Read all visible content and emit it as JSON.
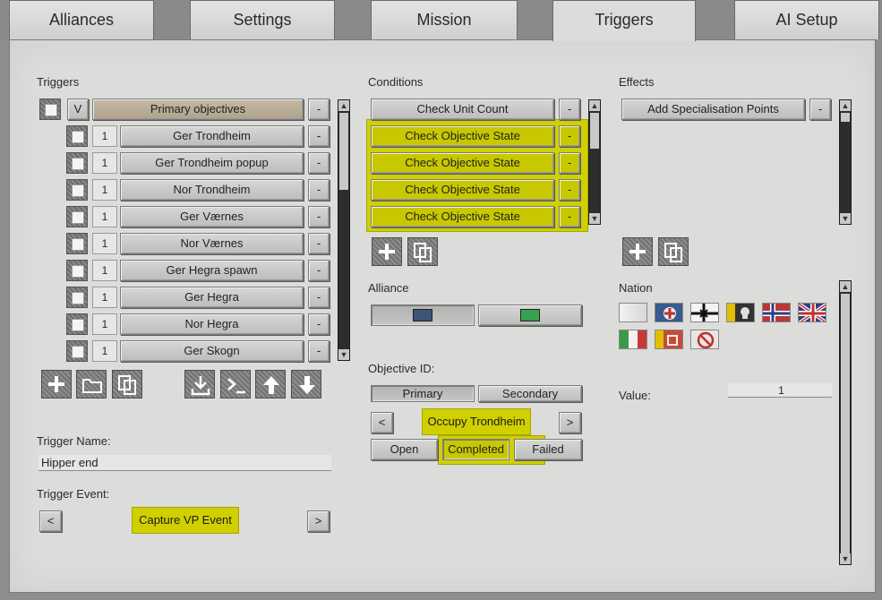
{
  "tabs": [
    "Alliances",
    "Settings",
    "Mission",
    "Triggers",
    "AI Setup"
  ],
  "triggers": {
    "heading": "Triggers",
    "group": {
      "toggle": "V",
      "label": "Primary objectives",
      "minus": "-"
    },
    "items": [
      {
        "count": "1",
        "label": "Ger Trondheim"
      },
      {
        "count": "1",
        "label": "Ger Trondheim popup"
      },
      {
        "count": "1",
        "label": "Nor Trondheim"
      },
      {
        "count": "1",
        "label": "Ger Værnes"
      },
      {
        "count": "1",
        "label": "Nor Værnes"
      },
      {
        "count": "1",
        "label": "Ger Hegra spawn"
      },
      {
        "count": "1",
        "label": "Ger Hegra"
      },
      {
        "count": "1",
        "label": "Nor Hegra"
      },
      {
        "count": "1",
        "label": "Ger Skogn"
      }
    ],
    "name_label": "Trigger Name:",
    "name_value": "Hipper end",
    "event_label": "Trigger Event:",
    "event_value": "Capture VP Event",
    "prev": "<",
    "next": ">"
  },
  "conditions": {
    "heading": "Conditions",
    "items": [
      "Check Unit Count",
      "Check Objective State",
      "Check Objective State",
      "Check Objective State",
      "Check Objective State"
    ],
    "alliance_label": "Alliance",
    "alliance_colors": [
      "#3e5478",
      "#38a050"
    ],
    "objective_label": "Objective ID:",
    "objective_types": [
      "Primary",
      "Secondary"
    ],
    "objective_value": "Occupy Trondheim",
    "states": [
      "Open",
      "Completed",
      "Failed"
    ],
    "prev": "<",
    "next": ">"
  },
  "effects": {
    "heading": "Effects",
    "items": [
      "Add Specialisation Points"
    ],
    "nation_label": "Nation",
    "value_label": "Value:",
    "value": "1"
  },
  "minus": "-",
  "highlight_color": "#d0d000"
}
